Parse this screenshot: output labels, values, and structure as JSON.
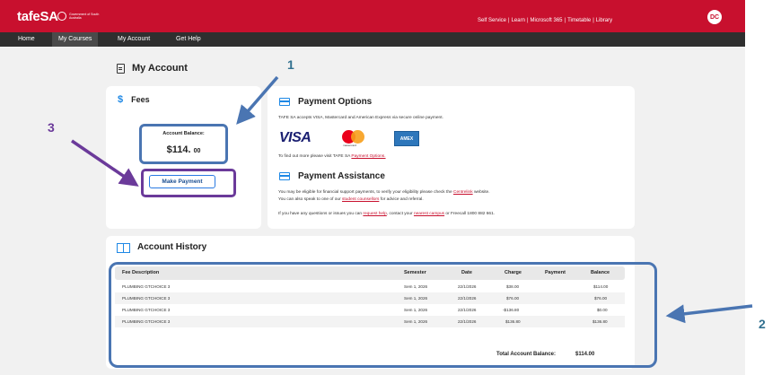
{
  "header": {
    "logo": "tafeSA",
    "gov_logo_text": "Government of South Australia",
    "links": [
      "Self Service",
      "Learn",
      "Microsoft 365",
      "Timetable",
      "Library"
    ],
    "avatar_initials": "DC"
  },
  "nav": {
    "items": [
      "Home",
      "My Courses",
      "My Account",
      "Get Help"
    ],
    "active": "My Courses"
  },
  "page": {
    "title": "My Account"
  },
  "fees": {
    "title": "Fees",
    "balance_label": "Account Balance:",
    "balance_dollars": "$114.",
    "balance_cents": "00",
    "make_payment_label": "Make Payment"
  },
  "payment_options": {
    "title": "Payment Options",
    "text": "TAFE SA accepts VISA, Mastercard and American Express via secure online payment.",
    "visa": "VISA",
    "mastercard": "mastercard",
    "amex": "AMEX",
    "find_out_prefix": "To find out more please visit TAFE SA ",
    "find_out_link": "Payment Options."
  },
  "payment_assistance": {
    "title": "Payment Assistance",
    "line1_prefix": "You may be eligible for financial support payments, to verify your eligibility please check the ",
    "line1_link": "Centrelink",
    "line1_suffix": " website.",
    "line2_prefix": "You can also speak to one of our ",
    "line2_link": "student counsellors",
    "line2_suffix": " for advice and referral.",
    "line3_prefix": "If you have any questions or issues you can ",
    "line3_link1": "request help",
    "line3_mid": ", contact your ",
    "line3_link2": "nearest campus",
    "line3_suffix": " or Freecall 1800 882 661."
  },
  "history": {
    "title": "Account History",
    "columns": {
      "description": "Fee Description",
      "semester": "Semester",
      "date": "Date",
      "charge": "Charge",
      "payment": "Payment",
      "balance": "Balance"
    },
    "rows": [
      {
        "description": "PLUMBING GTCHOICE 3",
        "semester": "Sem 1, 2026",
        "date": "22/1/2026",
        "charge": "$38.00",
        "payment": "",
        "balance": "$114.00"
      },
      {
        "description": "PLUMBING GTCHOICE 3",
        "semester": "Sem 1, 2026",
        "date": "22/1/2026",
        "charge": "$76.00",
        "payment": "",
        "balance": "$76.00"
      },
      {
        "description": "PLUMBING GTCHOICE 3",
        "semester": "Sem 1, 2026",
        "date": "22/1/2026",
        "charge": "-$136.80",
        "payment": "",
        "balance": "$0.00"
      },
      {
        "description": "PLUMBING GTCHOICE 3",
        "semester": "Sem 1, 2026",
        "date": "22/1/2026",
        "charge": "$136.80",
        "payment": "",
        "balance": "$136.80"
      }
    ],
    "total_label": "Total Account Balance:",
    "total_value": "$114.00"
  },
  "annotations": {
    "callout_1": "1",
    "callout_2": "2",
    "callout_3": "3",
    "blue": "#4a75b2",
    "purple": "#6b3a9a"
  }
}
